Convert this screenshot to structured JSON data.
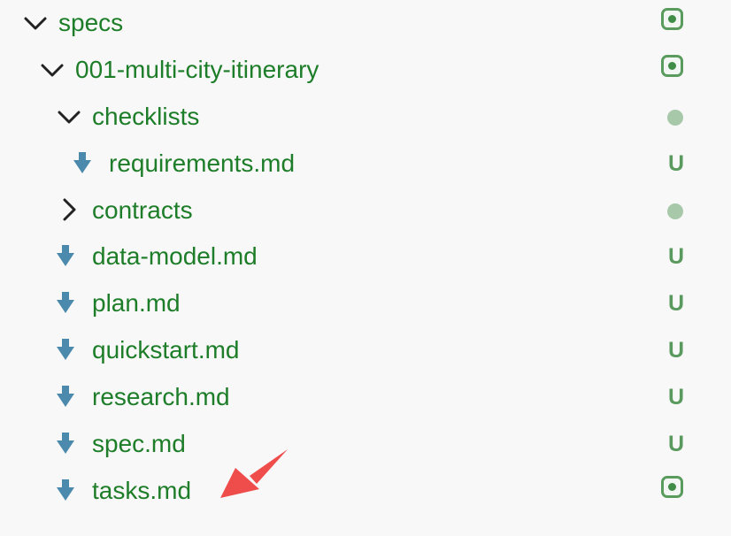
{
  "explorer": {
    "rows": [
      {
        "label": "specs",
        "kind": "folder",
        "expanded": true,
        "status": "modified-folder-indicator"
      },
      {
        "label": "001-multi-city-itinerary",
        "kind": "folder",
        "expanded": true,
        "status": "modified-folder-indicator"
      },
      {
        "label": "checklists",
        "kind": "folder",
        "expanded": true,
        "status": "untracked-folder-dot"
      },
      {
        "label": "requirements.md",
        "kind": "markdown-file",
        "git": "U"
      },
      {
        "label": "contracts",
        "kind": "folder",
        "expanded": false,
        "status": "untracked-folder-dot"
      },
      {
        "label": "data-model.md",
        "kind": "markdown-file",
        "git": "U"
      },
      {
        "label": "plan.md",
        "kind": "markdown-file",
        "git": "U"
      },
      {
        "label": "quickstart.md",
        "kind": "markdown-file",
        "git": "U"
      },
      {
        "label": "research.md",
        "kind": "markdown-file",
        "git": "U"
      },
      {
        "label": "spec.md",
        "kind": "markdown-file",
        "git": "U"
      },
      {
        "label": "tasks.md",
        "kind": "markdown-file",
        "status": "modified-file-indicator"
      }
    ],
    "icons": {
      "chevron_down": "chevron-down-icon",
      "chevron_right": "chevron-right-icon",
      "markdown_file": "download-arrow-icon",
      "annotation": "annotation-arrow-icon"
    },
    "colors": {
      "background": "#f8f8f8",
      "label_green": "#1d7d28",
      "git_green": "#5b9a5f",
      "untracked_dot": "#a8c8aa",
      "file_icon_blue": "#4b8aac",
      "annotation_red": "#ef4d4b"
    }
  }
}
